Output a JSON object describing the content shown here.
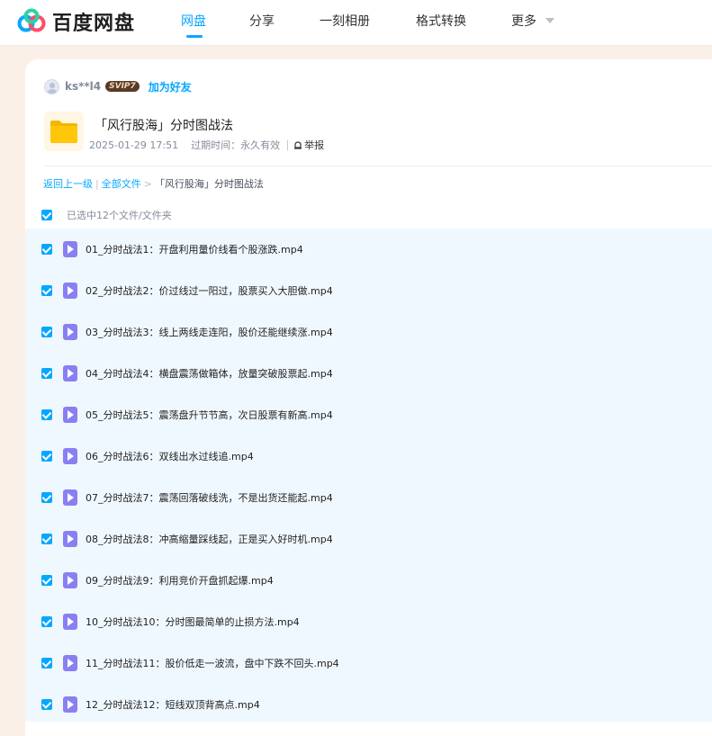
{
  "header": {
    "logo_text": "百度网盘",
    "nav": [
      {
        "label": "网盘",
        "active": true
      },
      {
        "label": "分享",
        "active": false
      },
      {
        "label": "一刻相册",
        "active": false
      },
      {
        "label": "格式转换",
        "active": false
      },
      {
        "label": "更多",
        "active": false
      }
    ]
  },
  "share": {
    "username": "ks**l4",
    "vip_badge": "SVIP7",
    "add_friend": "加为好友",
    "title": "「风行股海」分时图战法",
    "date": "2025-01-29 17:51",
    "expiry_label": "过期时间：",
    "expiry_value": "永久有效",
    "report": "举报"
  },
  "breadcrumb": {
    "back": "返回上一级",
    "all_files": "全部文件",
    "current": "「风行股海」分时图战法"
  },
  "selection": {
    "summary": "已选中12个文件/文件夹"
  },
  "files": [
    {
      "name": "01_分时战法1：开盘利用量价线看个股涨跌.mp4"
    },
    {
      "name": "02_分时战法2：价过线过一阳过，股票买入大胆做.mp4"
    },
    {
      "name": "03_分时战法3：线上两线走连阳，股价还能继续涨.mp4"
    },
    {
      "name": "04_分时战法4：横盘震荡做箱体，放量突破股票起.mp4"
    },
    {
      "name": "05_分时战法5：震荡盘升节节高，次日股票有新高.mp4"
    },
    {
      "name": "06_分时战法6：双线出水过线追.mp4"
    },
    {
      "name": "07_分时战法7：震荡回落破线洗，不是出货还能起.mp4"
    },
    {
      "name": "08_分时战法8：冲高缩量踩线起，正是买入好时机.mp4"
    },
    {
      "name": "09_分时战法9：利用竞价开盘抓起爆.mp4"
    },
    {
      "name": "10_分时战法10：分时图最简单的止损方法.mp4"
    },
    {
      "name": "11_分时战法11：股价低走一波流，盘中下跌不回头.mp4"
    },
    {
      "name": "12_分时战法12：短线双顶背高点.mp4"
    }
  ],
  "colors": {
    "accent": "#06a7ff",
    "selected_row_bg": "#f0f8ff",
    "page_bg": "#fbf0e8",
    "video_icon": "#8a7ff2"
  }
}
